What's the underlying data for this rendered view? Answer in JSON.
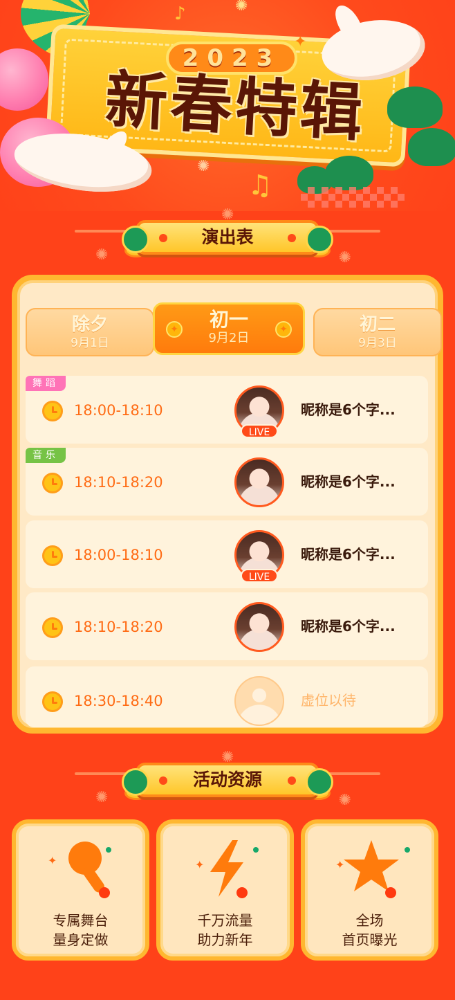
{
  "hero": {
    "year": "2023",
    "title": "新春特辑"
  },
  "schedule": {
    "header": "演出表",
    "tabs": [
      {
        "name": "除夕",
        "date": "9月1日",
        "active": false
      },
      {
        "name": "初一",
        "date": "9月2日",
        "active": true
      },
      {
        "name": "初二",
        "date": "9月3日",
        "active": false
      }
    ],
    "slots": [
      {
        "tag": "舞蹈",
        "time": "18:00-18:10",
        "live": "LIVE",
        "nickname": "昵称是6个字..."
      },
      {
        "tag": "音乐",
        "time": "18:10-18:20",
        "live": "",
        "nickname": "昵称是6个字..."
      },
      {
        "tag": "",
        "time": "18:00-18:10",
        "live": "LIVE",
        "nickname": "昵称是6个字..."
      },
      {
        "tag": "",
        "time": "18:10-18:20",
        "live": "",
        "nickname": "昵称是6个字..."
      },
      {
        "tag": "",
        "time": "18:30-18:40",
        "live": "",
        "nickname": "虚位以待"
      }
    ]
  },
  "resources": {
    "header": "活动资源",
    "cards": [
      {
        "icon": "microphone-icon",
        "line1": "专属舞台",
        "line2": "量身定做"
      },
      {
        "icon": "lightning-icon",
        "line1": "千万流量",
        "line2": "助力新年"
      },
      {
        "icon": "star-icon",
        "line1": "全场",
        "line2": "首页曝光"
      }
    ]
  },
  "colors": {
    "background": "#ff4219",
    "accent": "#ff7b0c",
    "gold": "#ffb730",
    "text_dark": "#3a1a0c"
  }
}
